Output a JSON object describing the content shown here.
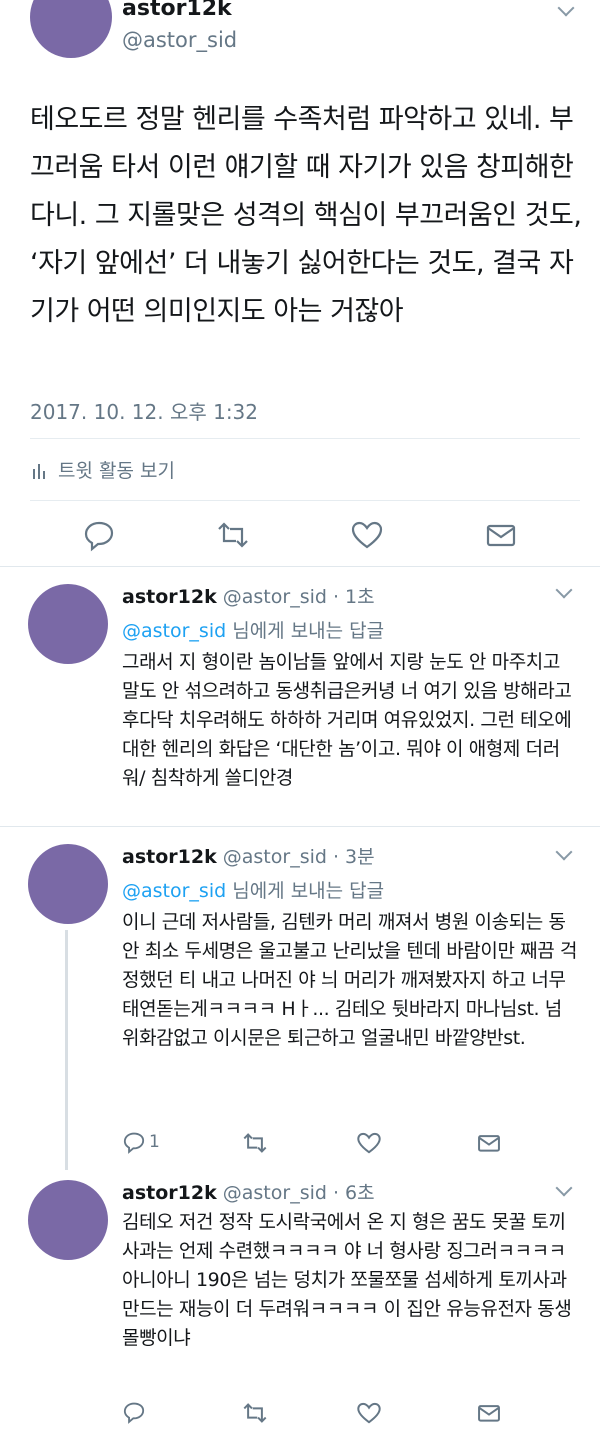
{
  "main": {
    "name": "astor12k",
    "handle": "@astor_sid",
    "text": "테오도르 정말 헨리를 수족처럼 파악하고 있네. 부끄러움 타서 이런 얘기할 때 자기가 있음 창피해한다니. 그 지롤맞은 성격의 핵심이 부끄러움인 것도, ‘자기 앞에선’ 더 내놓기 싫어한다는 것도, 결국 자기가 어떤 의미인지도 아는 거잖아",
    "timestamp": "2017. 10. 12. 오후 1:32",
    "activity_label": "트윗 활동 보기"
  },
  "replies": [
    {
      "name": "astor12k",
      "handle_time": "@astor_sid · 1초",
      "mention": "@astor_sid",
      "mention_suffix": " 님에게 보내는 답글",
      "text": "그래서 지 형이란 놈이남들 앞에서 지랑 눈도 안 마주치고 말도 안 섞으려하고 동생취급은커녕 너 여기 있음 방해라고 후다닥 치우려해도 하하하 거리며 여유있었지. 그런 테오에 대한 헨리의 화답은 ‘대단한 놈’이고. 뭐야 이 애형제 더러워/ 침착하게 쓸디안경"
    },
    {
      "name": "astor12k",
      "handle_time": "@astor_sid · 3분",
      "mention": "@astor_sid",
      "mention_suffix": " 님에게 보내는 답글",
      "text": "이니 근데 저사람들, 김텐카 머리 깨져서 병원 이송되는 동안 최소 두세명은 울고불고 난리났을 텐데 바람이만 째끔 걱정했던 티 내고 나머진 야 늬 머리가 깨져봤자지 하고 너무 태연돋는게ㅋㅋㅋㅋ Hㅏ... 김테오 뒷바라지 마나님st. 넘 위화감없고 이시문은 퇴근하고 얼굴내민 바깥양반st.",
      "reply_count": "1"
    },
    {
      "name": "astor12k",
      "handle_time": "@astor_sid · 6초",
      "text": "김테오 저건 정작 도시락국에서 온 지 형은 꿈도 못꿀 토끼사과는 언제 수련했ㅋㅋㅋㅋ 야 너 형사랑 징그러ㅋㅋㅋㅋ 아니아니 190은 넘는 덩치가 쪼물쪼물 섬세하게 토끼사과 만드는 재능이 더 두려워ㅋㅋㅋㅋ 이 집안 유능유전자 동생몰빵이냐"
    }
  ],
  "icons": [
    "reply-icon",
    "retweet-icon",
    "like-icon",
    "message-icon",
    "chevron-down-icon",
    "bar-chart-icon"
  ],
  "colors": {
    "avatar": "#7a69a6",
    "mention": "#1da1f2",
    "muted": "#657786"
  }
}
